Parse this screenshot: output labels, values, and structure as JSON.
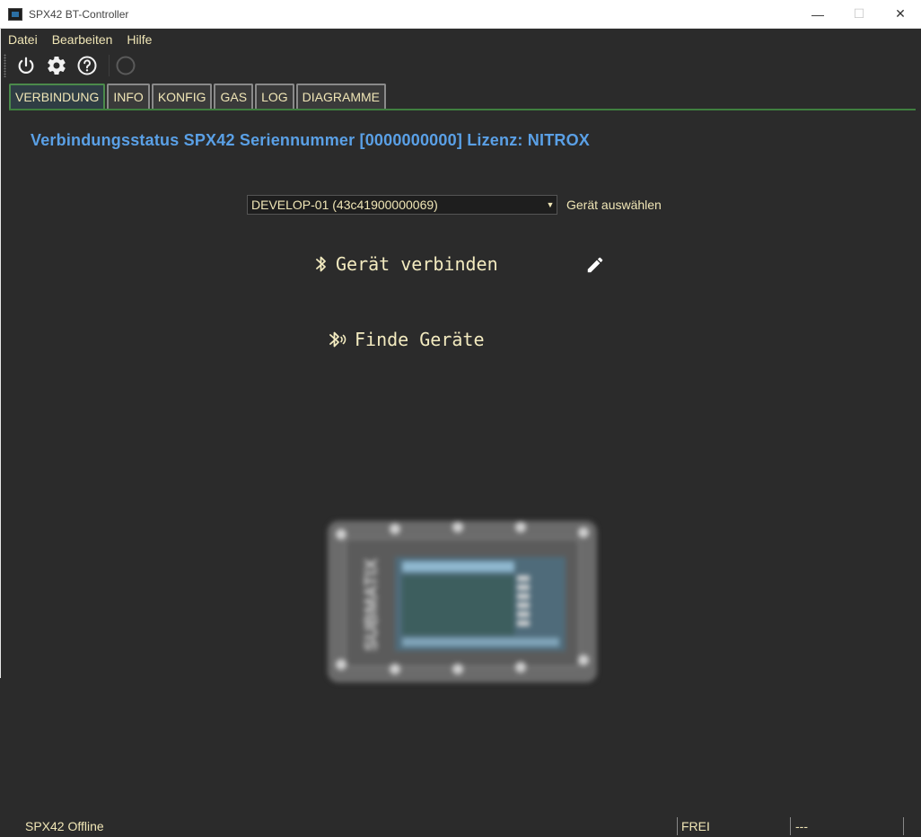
{
  "window": {
    "title": "SPX42 BT-Controller",
    "minimize": "—",
    "maximize": "☐",
    "close": "✕"
  },
  "menu": [
    "Datei",
    "Bearbeiten",
    "Hilfe"
  ],
  "toolbar": {
    "icons": [
      "power-icon",
      "gear-icon",
      "help-icon",
      "status-circle-icon"
    ]
  },
  "tabs": [
    "VERBINDUNG",
    "INFO",
    "KONFIG",
    "GAS",
    "LOG",
    "DIAGRAMME"
  ],
  "active_tab": "VERBINDUNG",
  "main": {
    "status_heading": "Verbindungsstatus SPX42 Seriennummer [0000000000] Lizenz: NITROX",
    "device_select_value": "DEVELOP-01 (43c41900000069)",
    "device_select_label": "Gerät auswählen",
    "connect_label": "Gerät verbinden",
    "find_label": "Finde Geräte",
    "device_image_text": "SUBMATIX"
  },
  "statusbar": {
    "left": "SPX42 Offline",
    "middle": "FREI",
    "right": "---"
  },
  "colors": {
    "background": "#2b2b2b",
    "text": "#f0e6b6",
    "heading": "#5aa0e6",
    "tab_active_border": "#4b8a4b"
  }
}
